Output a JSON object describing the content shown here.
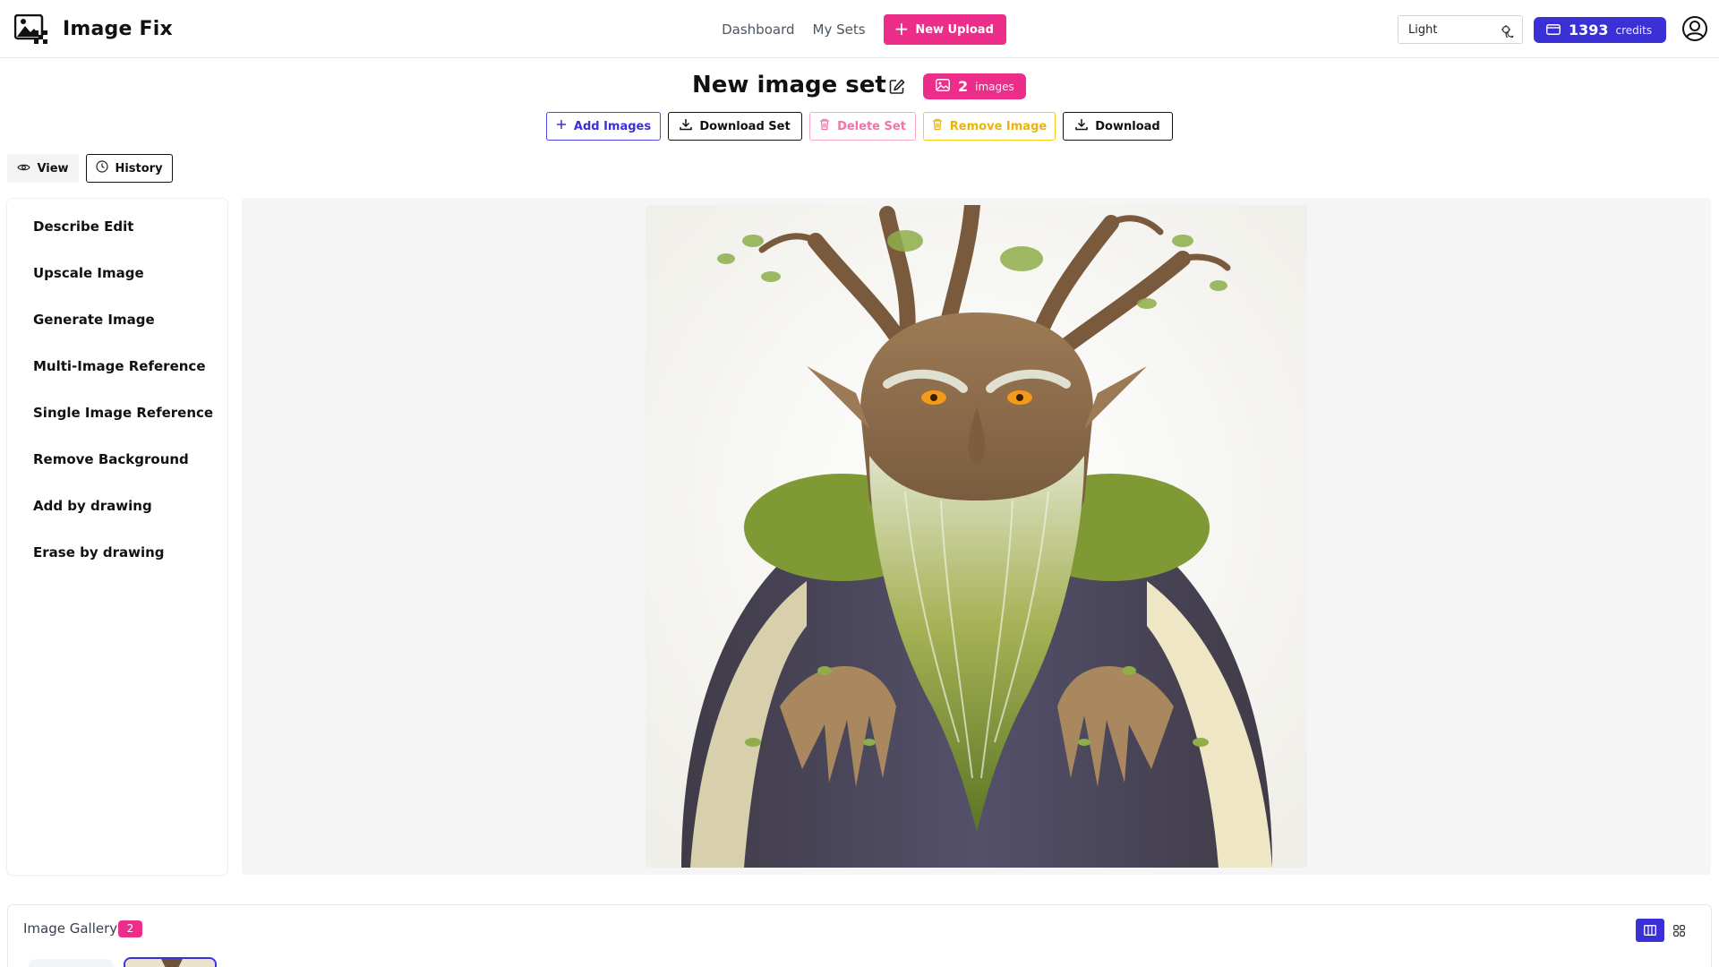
{
  "app": {
    "title": "Image Fix"
  },
  "nav": {
    "dashboard": "Dashboard",
    "my_sets": "My Sets",
    "new_upload": "New Upload"
  },
  "theme": {
    "selected": "Light"
  },
  "credits": {
    "count": "1393",
    "label": "credits"
  },
  "set": {
    "title": "New image set",
    "image_count": "2",
    "image_count_label": "images"
  },
  "actions": {
    "add_images": "Add Images",
    "download_set": "Download Set",
    "delete_set": "Delete Set",
    "remove_image": "Remove Image",
    "download": "Download"
  },
  "view_tabs": {
    "view": "View",
    "history": "History"
  },
  "tools": [
    "Describe Edit",
    "Upscale Image",
    "Generate Image",
    "Multi-Image Reference",
    "Single Image Reference",
    "Remove Background",
    "Add by drawing",
    "Erase by drawing"
  ],
  "gallery": {
    "title": "Image Gallery",
    "count": "2"
  },
  "colors": {
    "brand_pink": "#ec2d8a",
    "brand_indigo": "#3b30d6",
    "danger_soft": "#f472a8",
    "warning": "#eab308"
  },
  "icons": {
    "logo": "image-checker-logo-icon",
    "new_upload": "plus-icon",
    "theme": "theme-toggle-icon",
    "credits": "credit-card-icon",
    "account": "user-circle-icon",
    "edit": "pencil-square-icon",
    "images": "image-icon",
    "add": "plus-icon",
    "download": "download-icon",
    "delete": "trash-icon",
    "view": "eye-icon",
    "history": "clock-icon",
    "columns": "columns-icon",
    "grid": "grid-icon"
  }
}
